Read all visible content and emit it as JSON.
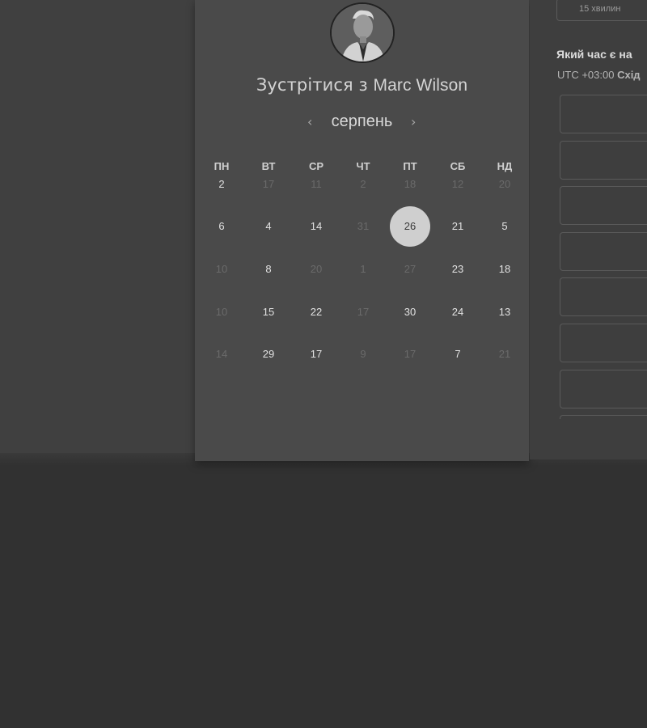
{
  "duration": {
    "label": "15 хвилин"
  },
  "host": {
    "title_prefix": "Зустрітися з ",
    "name": "Marc Wilson",
    "avatar_icon": "person-avatar-icon"
  },
  "calendar": {
    "month": "серпень",
    "prev_icon": "‹",
    "next_icon": "›",
    "weekdays": [
      "ПН",
      "ВТ",
      "СР",
      "ЧТ",
      "ПТ",
      "СБ",
      "НД"
    ],
    "weeks": [
      [
        {
          "label": "2",
          "available": true
        },
        {
          "label": "17",
          "available": false
        },
        {
          "label": "11",
          "available": false
        },
        {
          "label": "2",
          "available": false
        },
        {
          "label": "18",
          "available": false
        },
        {
          "label": "12",
          "available": false
        },
        {
          "label": "20",
          "available": false
        }
      ],
      [
        {
          "label": "6",
          "available": true
        },
        {
          "label": "4",
          "available": true
        },
        {
          "label": "14",
          "available": true
        },
        {
          "label": "31",
          "available": false
        },
        {
          "label": "26",
          "available": true,
          "selected": true
        },
        {
          "label": "21",
          "available": true
        },
        {
          "label": "5",
          "available": true
        }
      ],
      [
        {
          "label": "10",
          "available": false
        },
        {
          "label": "8",
          "available": true
        },
        {
          "label": "20",
          "available": false
        },
        {
          "label": "1",
          "available": false
        },
        {
          "label": "27",
          "available": false
        },
        {
          "label": "23",
          "available": true
        },
        {
          "label": "18",
          "available": true
        }
      ],
      [
        {
          "label": "10",
          "available": false
        },
        {
          "label": "15",
          "available": true
        },
        {
          "label": "22",
          "available": true
        },
        {
          "label": "17",
          "available": false
        },
        {
          "label": "30",
          "available": true
        },
        {
          "label": "24",
          "available": true
        },
        {
          "label": "13",
          "available": true
        }
      ],
      [
        {
          "label": "14",
          "available": false
        },
        {
          "label": "29",
          "available": true
        },
        {
          "label": "17",
          "available": true
        },
        {
          "label": "9",
          "available": false
        },
        {
          "label": "17",
          "available": false
        },
        {
          "label": "7",
          "available": true
        },
        {
          "label": "21",
          "available": false
        }
      ]
    ]
  },
  "time_panel": {
    "question": "Який час є на",
    "timezone_offset": "UTC +03:00",
    "timezone_name": "Схід",
    "slot_count": 7
  },
  "colors": {
    "selected_day_bg": "#cfcfcf",
    "available_text": "#e2e2e2",
    "unavailable_text": "#6a6a6a"
  }
}
